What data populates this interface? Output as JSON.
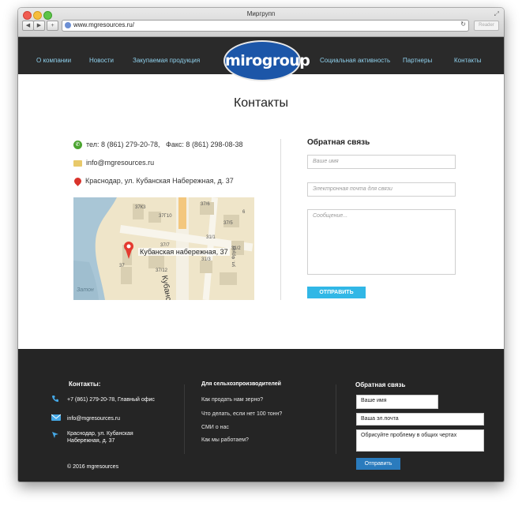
{
  "browser": {
    "window_title": "Миргрупп",
    "url": "www.mgresources.ru/",
    "back_label": "◀",
    "forward_label": "▶",
    "add_label": "+",
    "reader_label": "Reader"
  },
  "header": {
    "menu_left": [
      "О компании",
      "Новости",
      "Закупаемая продукция"
    ],
    "logo_text": "mirogroup",
    "menu_right": [
      "Социальная активность",
      "Партнеры",
      "Контакты"
    ]
  },
  "main": {
    "heading": "Контакты",
    "phone_text": "тел: 8 (861) 279-20-78,",
    "fax_text": "Факс: 8 (861) 298-08-38",
    "email_text": "info@mgresources.ru",
    "address_text": "Краснодар, ул. Кубанская Набережная, д. 37",
    "map": {
      "address_label": "Кубанская набережная, 37",
      "street_label": "Кубанская наб.",
      "street_label_right": "ул. Фрунз",
      "area_label": "Затон",
      "building_labels": [
        "37К3",
        "37Г10",
        "37/6",
        "37/5",
        "37/12",
        "37/7",
        "37",
        "31/3",
        "31/1",
        "31/2",
        "6"
      ]
    },
    "feedback": {
      "title": "Обратная связь",
      "name_placeholder": "Ваше имя",
      "email_placeholder": "Электронная почта для связи",
      "message_placeholder": "Сообщение...",
      "send_label": "ОТПРАВИТЬ"
    }
  },
  "footer": {
    "contacts_title": "Контакты:",
    "phone_text": "+7 (861) 279-20-78, Главный офис",
    "email_text": "info@mgresources.ru",
    "address_line1": "Краснодар, ул. Кубанская",
    "address_line2": "Набережная, д. 37",
    "copyright": "© 2016 mgresources",
    "farmers_title": "Для сельхозпроизводителей",
    "farmers_links": [
      "Как продать нам зерно?",
      "Что делать, если нет 100 тонн?",
      "СМИ о нас",
      "Как мы работаем?"
    ],
    "feedback_title": "Обратная связь",
    "name_value": "Ваше имя",
    "email_value": "Ваша эл.почта",
    "message_value": "Обрисуйте проблему в общих чертах",
    "send_label": "Отправить"
  },
  "colors": {
    "header_bg": "#2a2a2a",
    "menu_link": "#8fd0ec",
    "logo_bg": "#1c56a8",
    "send_button": "#31b7e6",
    "footer_bg": "#252525",
    "footer_button": "#2a7bbd"
  }
}
